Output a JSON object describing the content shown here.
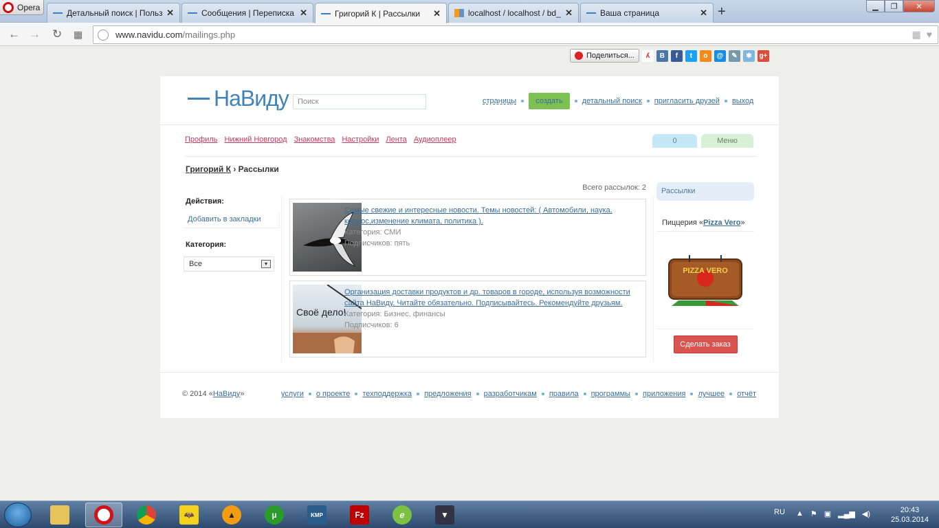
{
  "browser": {
    "opera_label": "Opera",
    "tabs": [
      {
        "title": "Детальный поиск | Польз"
      },
      {
        "title": "Сообщения | Переписка"
      },
      {
        "title": "Григорий К | Рассылки"
      },
      {
        "title": "localhost / localhost / bd_"
      },
      {
        "title": "Ваша страница"
      }
    ],
    "url_host": "www.navidu.com",
    "url_path": "/mailings.php"
  },
  "share": {
    "button_label": "Поделиться..."
  },
  "header": {
    "logo_text": "НаВиду",
    "search_placeholder": "Поиск",
    "links": {
      "pages": "страницы",
      "create": "создать",
      "detailed_search": "детальный поиск",
      "invite": "пригласить друзей",
      "logout": "выход"
    }
  },
  "menu": {
    "items": [
      "Профиль",
      "Нижний Новгород",
      "Знакомства",
      "Настройки",
      "Лента",
      "Аудиоплеер"
    ],
    "counter": "0",
    "menu_button": "Меню"
  },
  "breadcrumb": {
    "user": "Григорий К",
    "sep": "›",
    "current": "Рассылки"
  },
  "total": "Всего рассылок: 2",
  "left": {
    "actions_heading": "Действия:",
    "bookmark_link": "Добавить в закладки",
    "category_heading": "Категория:",
    "category_value": "Все"
  },
  "mailings": [
    {
      "title": "Самые свежие и интересные новости. Темы новостей: ( Автомобили, наука, космос,изменение климата, политика ).",
      "category": "Категория: СМИ",
      "subscribers": "Подписчиков: пять"
    },
    {
      "title": "Организация доставки продуктов и др. товаров в городе, используя возможности сайта НаВиду. Читайте обязательно. Подписывайтесь. Рекомендуйте друзьям.",
      "category": "Категория: Бизнес, финансы",
      "subscribers": "Подписчиков: 6",
      "thumb_text": "Своё дело!"
    }
  ],
  "right": {
    "tab_label": "Рассылки",
    "ad_prefix": "Пиццерия «",
    "ad_name": "Pizza Vero",
    "ad_suffix": "»",
    "ad_logo_text": "PIZZA VERO",
    "order_button": "Сделать заказ"
  },
  "footer": {
    "copy_prefix": "© 2014 «",
    "copy_link": "НаВиду",
    "copy_suffix": "»",
    "links": [
      "услуги",
      "о проекте",
      "техподдержка",
      "предложения",
      "разработчикам",
      "правила",
      "программы",
      "приложения",
      "лучшее",
      "отчёт"
    ]
  },
  "taskbar": {
    "lang": "RU",
    "time": "20:43",
    "date": "25.03.2014"
  }
}
